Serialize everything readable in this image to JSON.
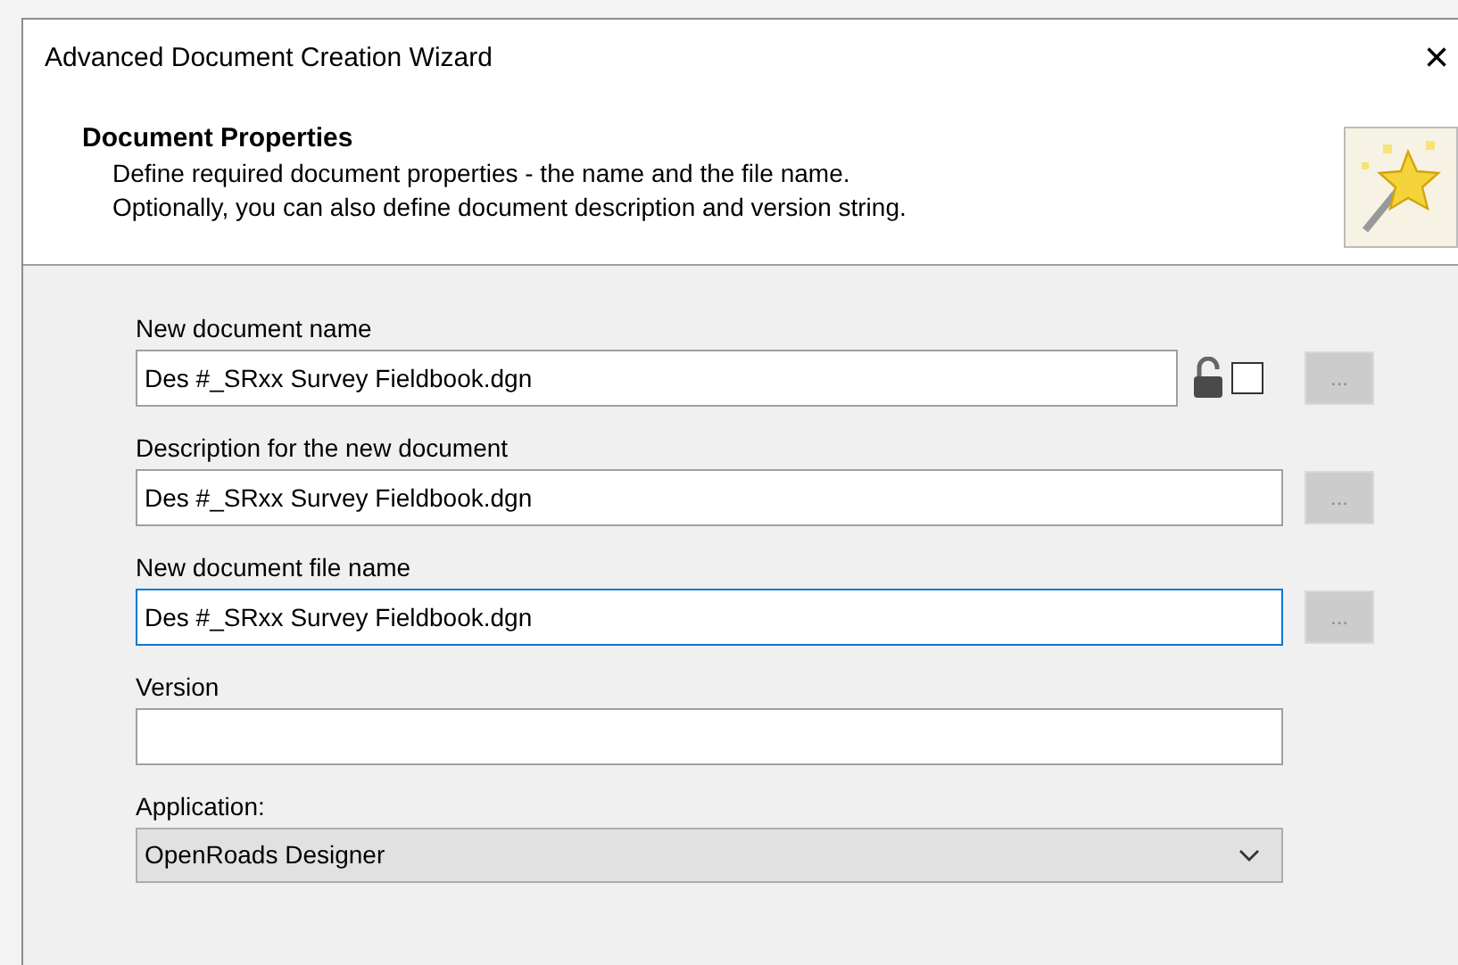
{
  "window": {
    "title": "Advanced Document Creation Wizard",
    "close": "×"
  },
  "header": {
    "title": "Document Properties",
    "description": [
      "Define required document properties - the name and the file name.",
      "Optionally, you can also define document description and version string."
    ]
  },
  "fields": [
    {
      "kind": "text",
      "label": "New document name",
      "value": "Des #_SRxx Survey Fieldbook.dgn",
      "focused": false,
      "lock": {
        "locked": false
      },
      "checkbox": {
        "checked": false
      },
      "browse": {
        "label": "...",
        "disabled": true
      }
    },
    {
      "kind": "text",
      "label": "Description for the new document",
      "value": "Des #_SRxx Survey Fieldbook.dgn",
      "focused": false,
      "browse": {
        "label": "...",
        "disabled": true
      }
    },
    {
      "kind": "text",
      "label": "New document file name",
      "value": "Des #_SRxx Survey Fieldbook.dgn",
      "focused": true,
      "browse": {
        "label": "...",
        "disabled": true
      }
    },
    {
      "kind": "text",
      "label": "Version",
      "focused": false
    },
    {
      "kind": "select",
      "label": "Application:",
      "value": "OpenRoads Designer"
    }
  ]
}
